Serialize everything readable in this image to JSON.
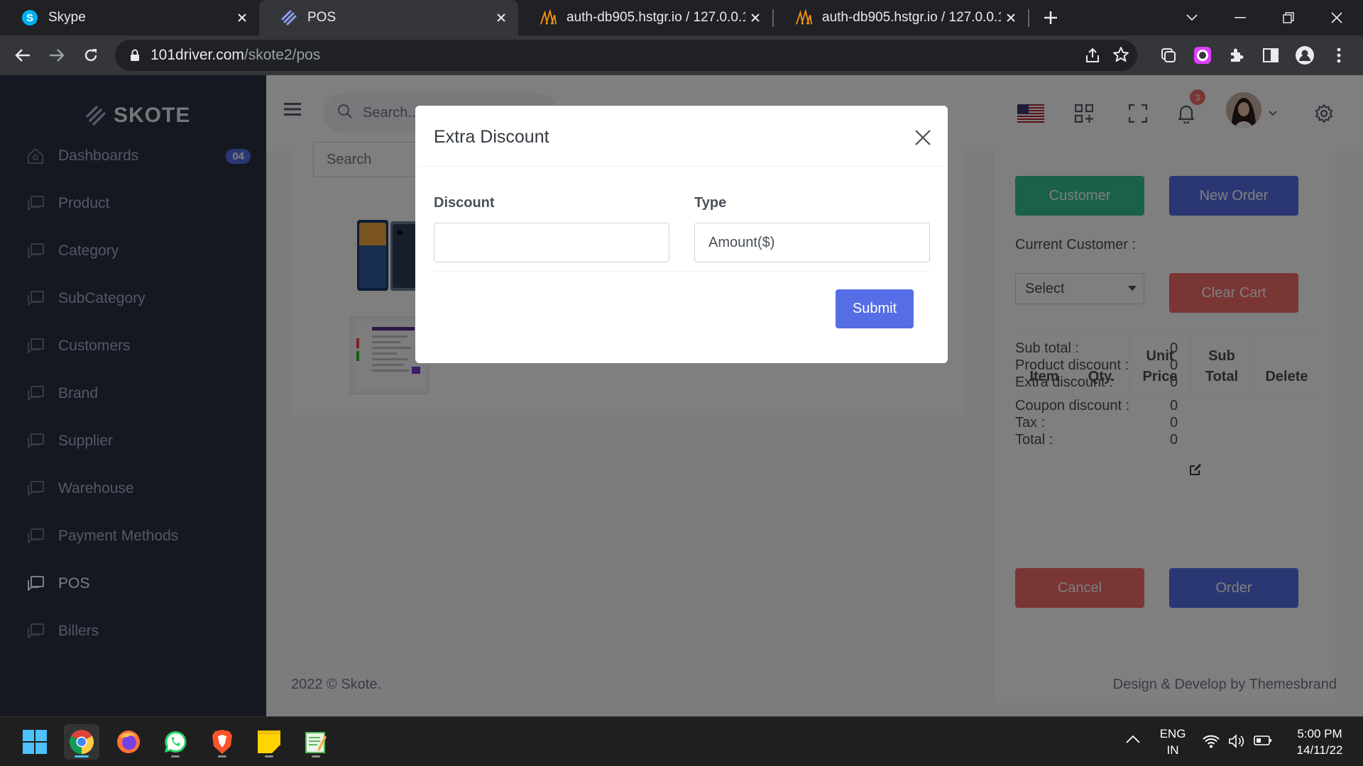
{
  "browser": {
    "tabs": [
      {
        "title": "Skype",
        "icon": "skype-icon"
      },
      {
        "title": "POS",
        "icon": "skote-icon"
      },
      {
        "title": "auth-db905.hstgr.io / 127.0.0.1 /",
        "icon": "phpmyadmin-icon"
      },
      {
        "title": "auth-db905.hstgr.io / 127.0.0.1 /",
        "icon": "phpmyadmin-icon"
      }
    ],
    "active_tab": 1,
    "url_domain": "101driver.com",
    "url_path": "/skote2/pos"
  },
  "sidebar": {
    "logo": "SKOTE",
    "items": [
      {
        "label": "Dashboards",
        "badge": "04"
      },
      {
        "label": "Product"
      },
      {
        "label": "Category"
      },
      {
        "label": "SubCategory"
      },
      {
        "label": "Customers"
      },
      {
        "label": "Brand"
      },
      {
        "label": "Supplier"
      },
      {
        "label": "Warehouse"
      },
      {
        "label": "Payment Methods"
      },
      {
        "label": "POS",
        "active": true
      },
      {
        "label": "Billers"
      }
    ]
  },
  "topbar": {
    "search_placeholder": "Search...",
    "notification_count": "3"
  },
  "products": {
    "search_placeholder": "Search"
  },
  "pos": {
    "customer_button": "Customer",
    "new_order_button": "New Order",
    "current_customer_label": "Current Customer :",
    "customer_select": "Select",
    "clear_cart_button": "Clear Cart",
    "cart_columns": [
      [
        "Item"
      ],
      [
        "Qty."
      ],
      [
        "Unit",
        "Price"
      ],
      [
        "Sub",
        "Total"
      ],
      [
        "Delete"
      ]
    ],
    "summary": [
      {
        "label": "Sub total :",
        "value": "0"
      },
      {
        "label": "Product discount :",
        "value": "0"
      },
      {
        "label": "Extra discount :",
        "value": "0"
      },
      {
        "label": "Coupon discount :",
        "value": "0"
      },
      {
        "label": "Tax :",
        "value": "0"
      },
      {
        "label": "Total :",
        "value": "0"
      }
    ],
    "cancel_button": "Cancel",
    "order_button": "Order"
  },
  "footer": {
    "copyright": "2022 © Skote.",
    "credit": "Design & Develop by Themesbrand"
  },
  "modal": {
    "title": "Extra Discount",
    "discount_label": "Discount",
    "discount_value": "",
    "type_label": "Type",
    "type_value": "Amount($)",
    "submit_label": "Submit"
  },
  "taskbar": {
    "apps": [
      "windows-start-icon",
      "chrome-icon",
      "firefox-icon",
      "whatsapp-icon",
      "brave-icon",
      "sticky-notes-icon",
      "notepad-icon"
    ],
    "language": "ENG",
    "region": "IN",
    "time": "5:00 PM",
    "date": "14/11/22"
  },
  "colors": {
    "sidebar_bg": "#2a3042",
    "primary": "#556ee6",
    "success": "#34c38f",
    "danger": "#f46a6a"
  }
}
